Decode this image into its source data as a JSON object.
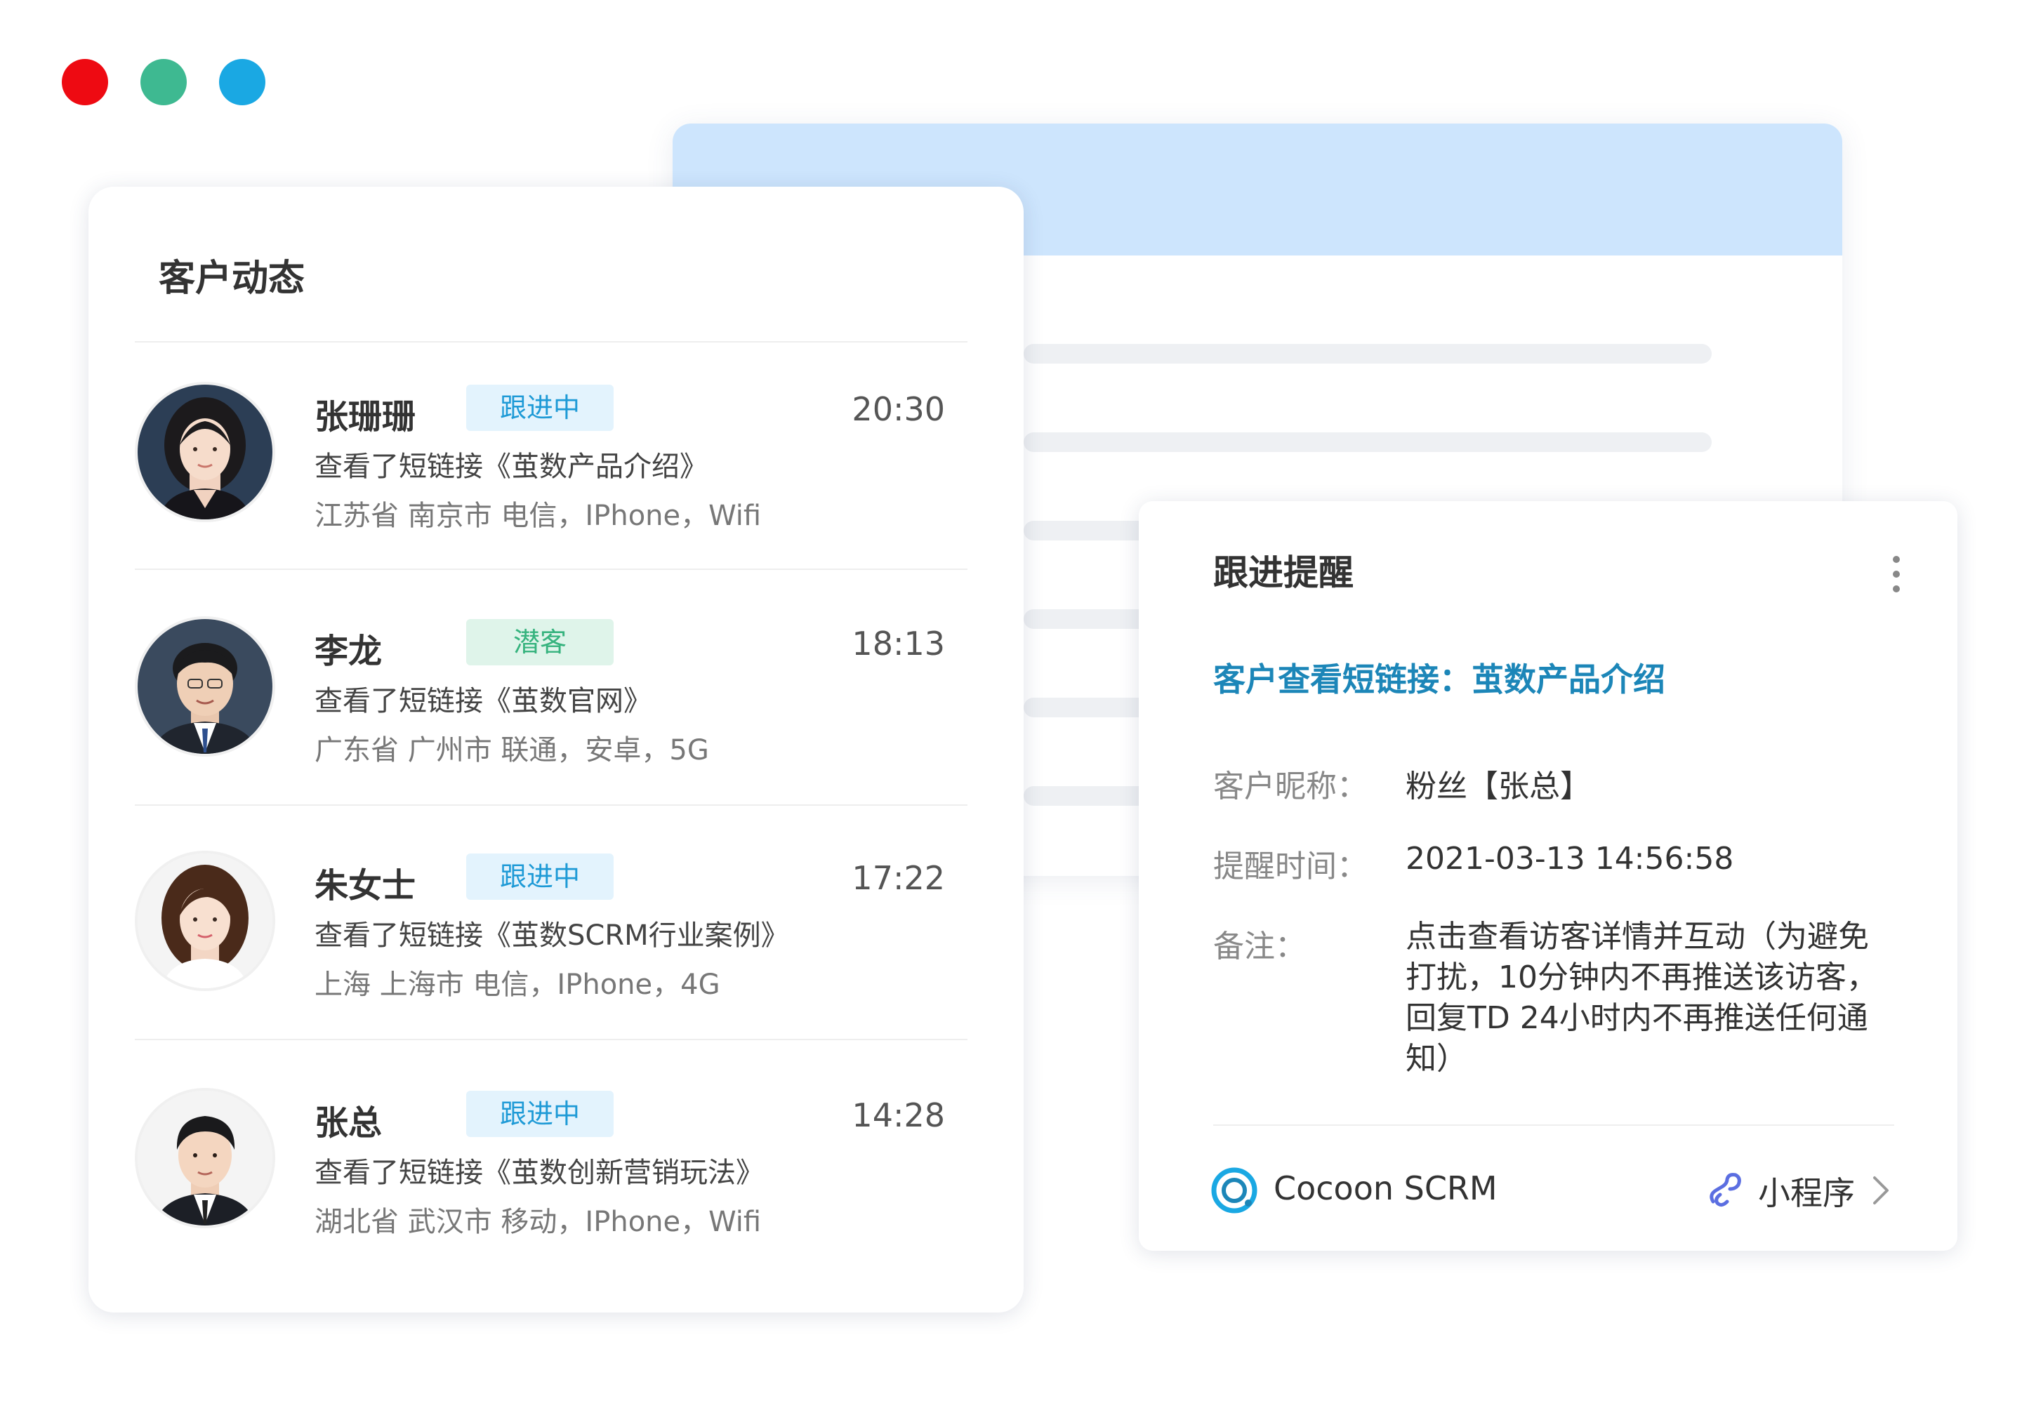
{
  "window_controls": {
    "colors": {
      "close": "#ee0a12",
      "minimize": "#3eb991",
      "maximize": "#1aa8e3"
    }
  },
  "activity": {
    "title": "客户动态",
    "entries": [
      {
        "name": "张珊珊",
        "tag": "跟进中",
        "tag_color": "blue",
        "time": "20:30",
        "action": "查看了短链接《茧数产品介绍》",
        "meta": "江苏省 南京市 电信，IPhone，Wifi",
        "avatar": "female-avatar"
      },
      {
        "name": "李龙",
        "tag": "潜客",
        "tag_color": "green",
        "time": "18:13",
        "action": "查看了短链接《茧数官网》",
        "meta": "广东省 广州市 联通，安卓，5G",
        "avatar": "male-avatar"
      },
      {
        "name": "朱女士",
        "tag": "跟进中",
        "tag_color": "blue",
        "time": "17:22",
        "action": "查看了短链接《茧数SCRM行业案例》",
        "meta": "上海 上海市 电信，IPhone，4G",
        "avatar": "female-avatar"
      },
      {
        "name": "张总",
        "tag": "跟进中",
        "tag_color": "blue",
        "time": "14:28",
        "action": "查看了短链接《茧数创新营销玩法》",
        "meta": "湖北省 武汉市 移动，IPhone，Wifi",
        "avatar": "male-avatar"
      }
    ]
  },
  "reminder": {
    "title": "跟进提醒",
    "headline": "客户查看短链接：茧数产品介绍",
    "fields": {
      "nickname_label": "客户昵称：",
      "nickname_value": "粉丝【张总】",
      "time_label": "提醒时间：",
      "time_value": "2021-03-13 14:56:58",
      "note_label": "备注：",
      "note_value": "点击查看访客详情并互动（为避免打扰，10分钟内不再推送该访客，回复TD 24小时内不再推送任何通知）"
    },
    "footer": {
      "brand": "Cocoon SCRM",
      "mini_program": "小程序"
    }
  },
  "colors": {
    "accent_blue": "#1c86b8",
    "tag_blue_bg": "#e3f3fd",
    "tag_green_bg": "#dff4ea",
    "header_band": "#cde5fd"
  }
}
